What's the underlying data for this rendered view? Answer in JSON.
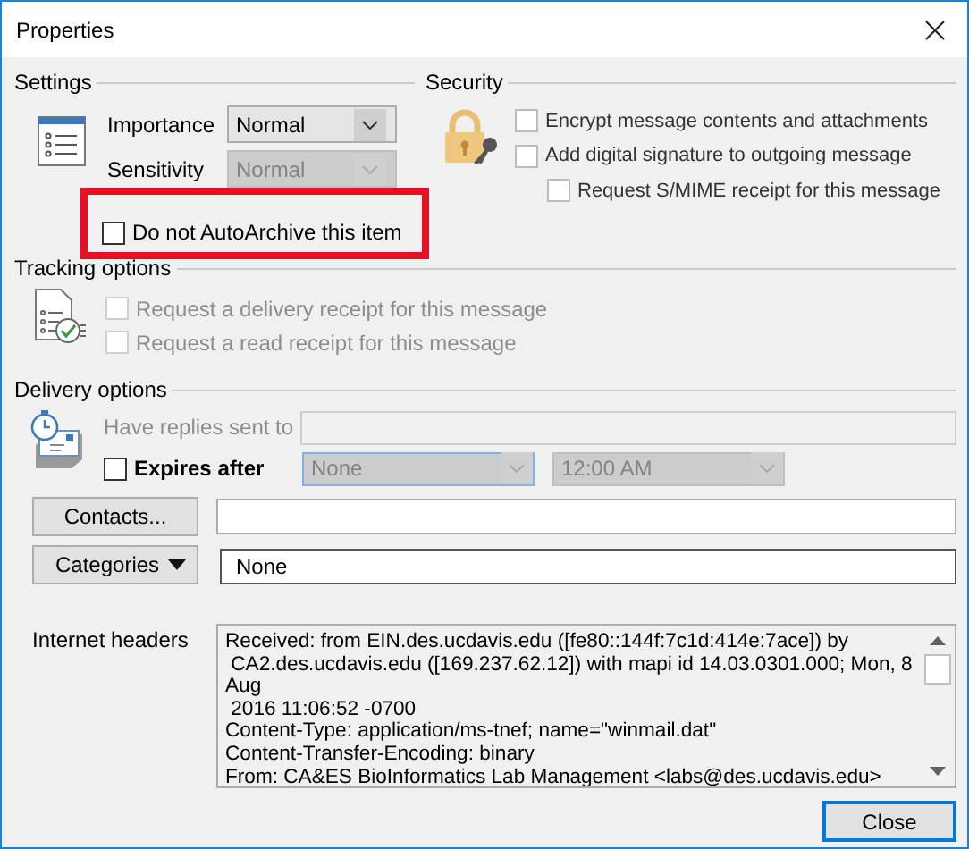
{
  "window": {
    "title": "Properties"
  },
  "settings": {
    "heading": "Settings",
    "fields": [
      {
        "label": "Importance",
        "value": "Normal",
        "disabled": false
      },
      {
        "label": "Sensitivity",
        "value": "Normal",
        "disabled": true
      }
    ],
    "autoarchive": {
      "label": "Do not AutoArchive this item",
      "checked": false,
      "highlighted": true
    }
  },
  "security": {
    "heading": "Security",
    "options": [
      {
        "label": "Encrypt message contents and attachments",
        "checked": false,
        "indented": false
      },
      {
        "label": "Add digital signature to outgoing message",
        "checked": false,
        "indented": false
      },
      {
        "label": "Request S/MIME receipt for this message",
        "checked": false,
        "indented": true
      }
    ]
  },
  "tracking": {
    "heading": "Tracking options",
    "options": [
      {
        "label": "Request a delivery receipt for this message",
        "checked": false,
        "disabled": true
      },
      {
        "label": "Request a read receipt for this message",
        "checked": false,
        "disabled": true
      }
    ]
  },
  "delivery": {
    "heading": "Delivery options",
    "replies": {
      "label": "Have replies sent to",
      "disabled": true
    },
    "expires": {
      "label": "Expires after",
      "checked": false,
      "date": "None",
      "time": "12:00 AM"
    }
  },
  "contacts": {
    "label": "Contacts..."
  },
  "categories": {
    "label": "Categories",
    "value": "None"
  },
  "internet_headers": {
    "label": "Internet headers",
    "lines": [
      "Received: from EIN.des.ucdavis.edu ([fe80::144f:7c1d:414e:7ace]) by",
      " CA2.des.ucdavis.edu ([169.237.62.12]) with mapi id 14.03.0301.000; Mon, 8",
      "Aug",
      " 2016 11:06:52 -0700",
      "Content-Type: application/ms-tnef; name=\"winmail.dat\"",
      "Content-Transfer-Encoding: binary",
      "From: CA&ES BioInformatics Lab Management <labs@des.ucdavis.edu>"
    ]
  },
  "buttons": [
    {
      "label": "Close",
      "default": true
    }
  ]
}
